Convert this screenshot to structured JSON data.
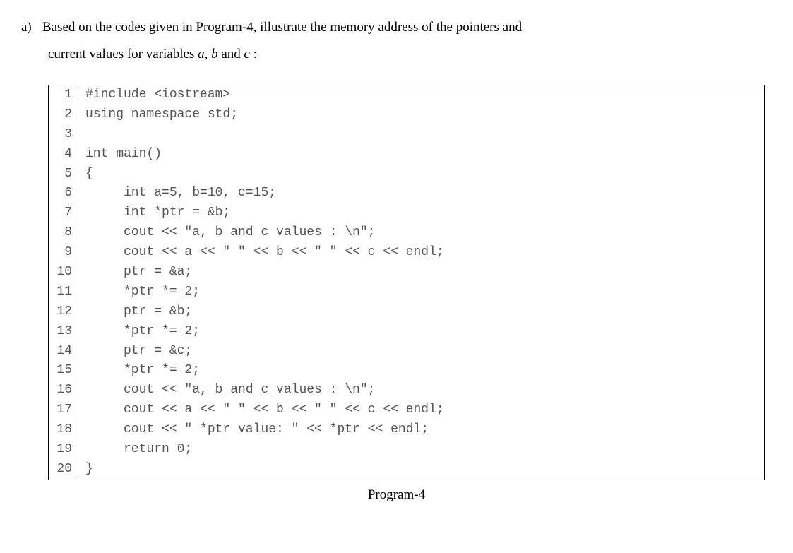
{
  "question": {
    "label": "a)",
    "line1": "Based on the codes given in Program-4, illustrate the memory address of the pointers and",
    "line2_prefix": "current values for variables ",
    "var_a": "a, ",
    "var_b": "b ",
    "line2_mid": "and ",
    "var_c": "c ",
    "line2_suffix": ":"
  },
  "code": {
    "lines": [
      {
        "n": "1",
        "t": "#include <iostream>"
      },
      {
        "n": "2",
        "t": "using namespace std;"
      },
      {
        "n": "3",
        "t": ""
      },
      {
        "n": "4",
        "t": "int main()"
      },
      {
        "n": "5",
        "t": "{"
      },
      {
        "n": "6",
        "t": "     int a=5, b=10, c=15;"
      },
      {
        "n": "7",
        "t": "     int *ptr = &b;"
      },
      {
        "n": "8",
        "t": "     cout << \"a, b and c values : \\n\";"
      },
      {
        "n": "9",
        "t": "     cout << a << \" \" << b << \" \" << c << endl;"
      },
      {
        "n": "10",
        "t": "     ptr = &a;"
      },
      {
        "n": "11",
        "t": "     *ptr *= 2;"
      },
      {
        "n": "12",
        "t": "     ptr = &b;"
      },
      {
        "n": "13",
        "t": "     *ptr *= 2;"
      },
      {
        "n": "14",
        "t": "     ptr = &c;"
      },
      {
        "n": "15",
        "t": "     *ptr *= 2;"
      },
      {
        "n": "16",
        "t": "     cout << \"a, b and c values : \\n\";"
      },
      {
        "n": "17",
        "t": "     cout << a << \" \" << b << \" \" << c << endl;"
      },
      {
        "n": "18",
        "t": "     cout << \" *ptr value: \" << *ptr << endl;"
      },
      {
        "n": "19",
        "t": "     return 0;"
      },
      {
        "n": "20",
        "t": "}"
      }
    ]
  },
  "caption": "Program-4"
}
